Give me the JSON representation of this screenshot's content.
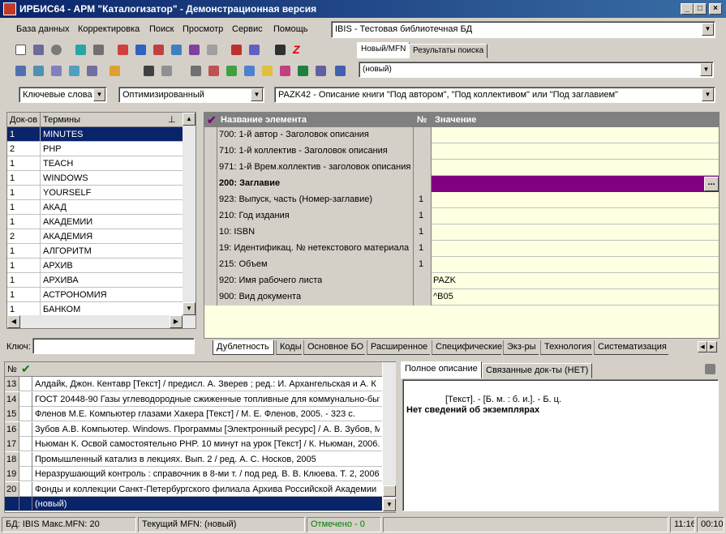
{
  "window": {
    "title": "ИРБИС64 - АРМ \"Каталогизатор\" - Демонстрационная версия",
    "minimize_glyph": "_",
    "maximize_glyph": "□",
    "close_glyph": "×"
  },
  "menu": [
    "База данных",
    "Корректировка",
    "Поиск",
    "Просмотр",
    "Сервис",
    "Помощь"
  ],
  "db_select": "IBIS - Тестовая библиотечная БД",
  "right_tabs": [
    "Новый/MFN",
    "Результаты поиска"
  ],
  "record_select": "(новый)",
  "search": {
    "mode": "Ключевые слова",
    "strategy": "Оптимизированный",
    "worksheet": "PAZK42 - Описание книги \"Под автором\", \"Под коллективом\" или \"Под заглавием\""
  },
  "terms": {
    "headers": [
      "Док-ов",
      "Термины"
    ],
    "rows": [
      [
        "1",
        "MINUTES"
      ],
      [
        "2",
        "PHP"
      ],
      [
        "1",
        "TEACH"
      ],
      [
        "1",
        "WINDOWS"
      ],
      [
        "1",
        "YOURSELF"
      ],
      [
        "1",
        "АКАД"
      ],
      [
        "1",
        "АКАДЕМИИ"
      ],
      [
        "2",
        "АКАДЕМИЯ"
      ],
      [
        "1",
        "АЛГОРИТМ"
      ],
      [
        "1",
        "АРХИВ"
      ],
      [
        "1",
        "АРХИВА"
      ],
      [
        "1",
        "АСТРОНОМИЯ"
      ],
      [
        "1",
        "БАНКОМ"
      ]
    ],
    "key_label": "Ключ:"
  },
  "fields": {
    "headers": [
      "Название элемента",
      "№",
      "Значение"
    ],
    "rows": [
      {
        "name": "700: 1-й  автор - Заголовок описания",
        "num": "",
        "value": ""
      },
      {
        "name": "710: 1-й коллектив - Заголовок описания",
        "num": "",
        "value": ""
      },
      {
        "name": "971: 1-й Врем.коллектив - заголовок описания",
        "num": "",
        "value": ""
      },
      {
        "name": "200: Заглавие",
        "num": "",
        "value": ""
      },
      {
        "name": "923: Выпуск, часть (Номер-заглавие)",
        "num": "1",
        "value": ""
      },
      {
        "name": "210: Год издания",
        "num": "1",
        "value": ""
      },
      {
        "name": "10: ISBN",
        "num": "1",
        "value": ""
      },
      {
        "name": "19: Идентификац. № нетекстового материала",
        "num": "1",
        "value": ""
      },
      {
        "name": "215: Объем",
        "num": "1",
        "value": ""
      },
      {
        "name": "920: Имя рабочего листа",
        "num": "",
        "value": "PAZK"
      },
      {
        "name": "900: Вид документа",
        "num": "",
        "value": "^B05"
      }
    ],
    "ellipsis": "..."
  },
  "bottom_tabs": [
    "Дублетность",
    "Коды",
    "Основное БО",
    "Расширенное",
    "Специфические",
    "Экз-ры",
    "Технология",
    "Систематизация"
  ],
  "records": {
    "header_num": "№",
    "rows": [
      [
        "13",
        "Алдайк, Джон. Кентавр [Текст] / предисл. А. Зверев ; ред.: И. Архангельская и А. К"
      ],
      [
        "14",
        "ГОСТ 20448-90 Газы углеводородные сжиженные топливные для коммунально-быт"
      ],
      [
        "15",
        "Фленов М.Е. Компьютер глазами Хакера [Текст] / М. Е. Фленов, 2005. - 323 с."
      ],
      [
        "16",
        "Зубов А.В. Компьютер. Windows. Программы [Электронный ресурс] / А. В. Зубов, М"
      ],
      [
        "17",
        "Ньюман К. Освой самостоятельно PHP. 10 минут на урок [Текст] / К. Ньюман, 2006."
      ],
      [
        "18",
        "Промышленный катализ в лекциях. Вып. 2 / ред. А. С. Носков, 2005"
      ],
      [
        "19",
        "Неразрушающий контроль : справочник в 8-ми т. / под ред. В. В. Клюева. Т. 2, 2006."
      ],
      [
        "20",
        "Фонды и коллекции Санкт-Петербургского филиала Архива Российской Академии н"
      ],
      [
        "",
        "(новый)"
      ]
    ]
  },
  "desc_tabs": [
    "Полное описание",
    "Связанные док-ты (НЕТ)"
  ],
  "description": {
    "line1": "[Текст]. - [Б. м. : б. и.]. - Б. ц.",
    "line2": "Нет сведений об экземплярах"
  },
  "status": {
    "db": "БД: IBIS Макс.MFN: 20",
    "current": "Текущий MFN: (новый)",
    "marked": "Отмечено - 0",
    "time1": "11:16",
    "time2": "00:10"
  },
  "colors": {
    "selection": "#0a246a",
    "active_field": "#800080",
    "field_bg": "#ffffe1",
    "marked_text": "#008000"
  }
}
